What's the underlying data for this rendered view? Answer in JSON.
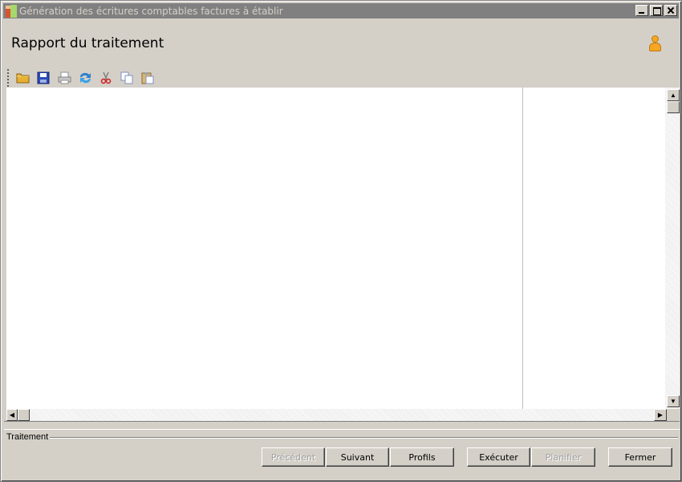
{
  "window": {
    "title": "Génération des écritures comptables factures à établir",
    "controls": [
      "minimize",
      "maximize",
      "close"
    ]
  },
  "header": {
    "title": "Rapport du traitement",
    "user_icon": "user-icon"
  },
  "toolbar": {
    "tools": [
      "open-folder-icon",
      "save-icon",
      "print-icon",
      "refresh-icon",
      "cut-icon",
      "copy-icon",
      "paste-icon"
    ]
  },
  "section": {
    "label": "Traitement"
  },
  "buttons": {
    "previous": "Précédent",
    "next": "Suivant",
    "profiles": "Profils",
    "execute": "Exécuter",
    "schedule": "Planifier",
    "close": "Fermer"
  }
}
